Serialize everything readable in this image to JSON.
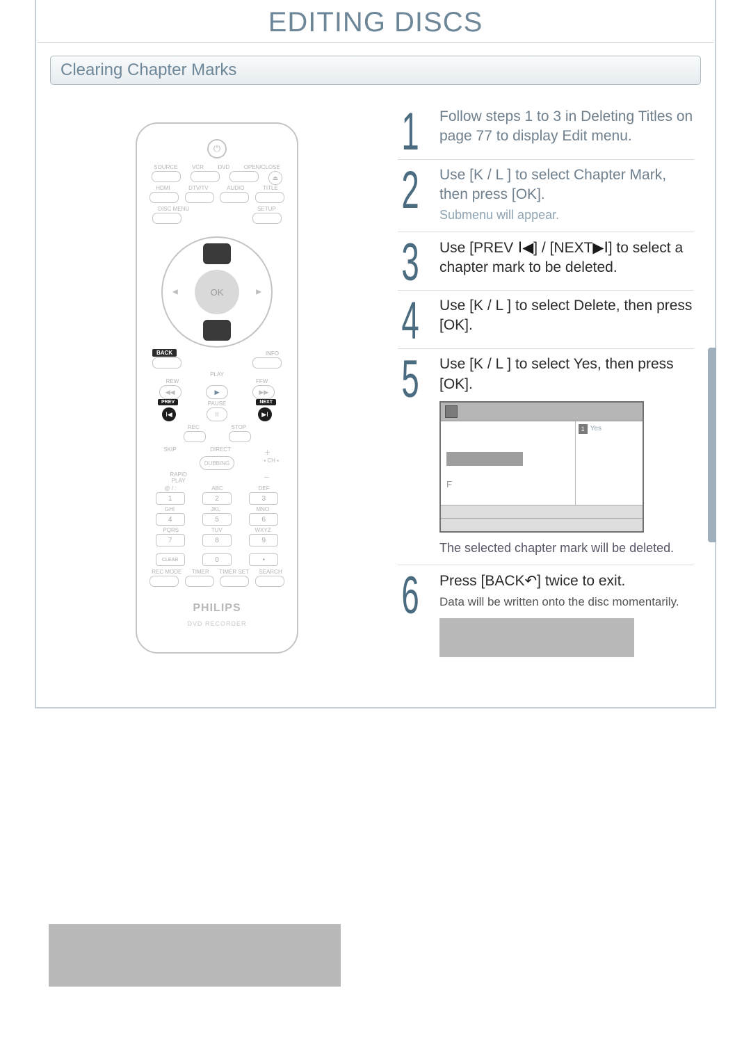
{
  "heading": "EDITING DISCS",
  "section_title": "Clearing Chapter Marks",
  "remote": {
    "power_icon": "⏻",
    "row1_labels": [
      "SOURCE",
      "VCR",
      "DVD",
      "OPEN/CLOSE"
    ],
    "row1_eject": "⏏",
    "row2_labels": [
      "HDMI",
      "DTV/TV",
      "AUDIO",
      "TITLE"
    ],
    "row3_labels": [
      "DISC MENU",
      "",
      "",
      "SETUP"
    ],
    "ok_label": "OK",
    "back_label": "BACK",
    "info_label": "INFO",
    "play_label": "PLAY",
    "rew_label": "REW",
    "ffw_label": "FFW",
    "rew_icon": "◀◀",
    "play_icon": "▶",
    "ffw_icon": "▶▶",
    "prev_label": "PREV",
    "pause_label": "PAUSE",
    "next_label": "NEXT",
    "prev_icon": "I◀",
    "pause_icon": "II",
    "next_icon": "▶I",
    "rec_label": "REC",
    "stop_label": "STOP",
    "skip_label": "SKIP",
    "direct_label": "DIRECT",
    "dubbing_label": "DUBBING",
    "ch_label": "▪ CH ▪",
    "rapid_label": "RAPID PLAY",
    "keypad_top_labels": [
      "@ / :",
      "ABC",
      "DEF"
    ],
    "keypad_row1": [
      "1",
      "2",
      "3"
    ],
    "keypad_row1_labels": [
      "GHI",
      "JKL",
      "MNO"
    ],
    "keypad_row2": [
      "4",
      "5",
      "6"
    ],
    "keypad_row2_labels": [
      "PQRS",
      "TUV",
      "WXYZ"
    ],
    "keypad_row3": [
      "7",
      "8",
      "9"
    ],
    "keypad_row4": [
      "CLEAR",
      "0",
      "•"
    ],
    "bottom_labels": [
      "REC MODE",
      "TIMER",
      "TIMER SET",
      "SEARCH"
    ],
    "brand": "PHILIPS",
    "sub_brand": "DVD RECORDER"
  },
  "steps": [
    {
      "n": "1",
      "text_a": "Follow steps 1 to 3 in",
      "text_b": "Deleting Titles",
      "text_c": "on page 77 to display",
      "text_d": "Edit",
      "text_e": "menu."
    },
    {
      "n": "2",
      "text_a": "Use [",
      "k": "K",
      "text_b": " / L ] to select",
      "target": "Chapter Mark",
      "text_c": ", then press [OK].",
      "sub": "Submenu will appear."
    },
    {
      "n": "3",
      "text_a": "Use [PREV",
      "icon_prev": " I◀",
      "text_b": "] / [NEXT",
      "icon_next": "▶I",
      "text_c": "] to select a chapter mark to be deleted."
    },
    {
      "n": "4",
      "text_a": "Use [",
      "k": "K",
      "text_b": " / L ] to select",
      "target": "Delete",
      "text_c": ", then press [OK]."
    },
    {
      "n": "5",
      "text_a": "Use [",
      "k": "K",
      "text_b": " / L ] to select",
      "target": "Yes",
      "text_c": ", then press [OK].",
      "osd_yes_num": "1",
      "osd_yes": "Yes",
      "osd_f": "F",
      "caption": "The selected chapter mark will be deleted."
    },
    {
      "n": "6",
      "text_a": "Press [BACK",
      "icon_back": "↶",
      "text_b": "] twice to exit.",
      "fine": "Data will be written onto the disc momentarily."
    }
  ]
}
